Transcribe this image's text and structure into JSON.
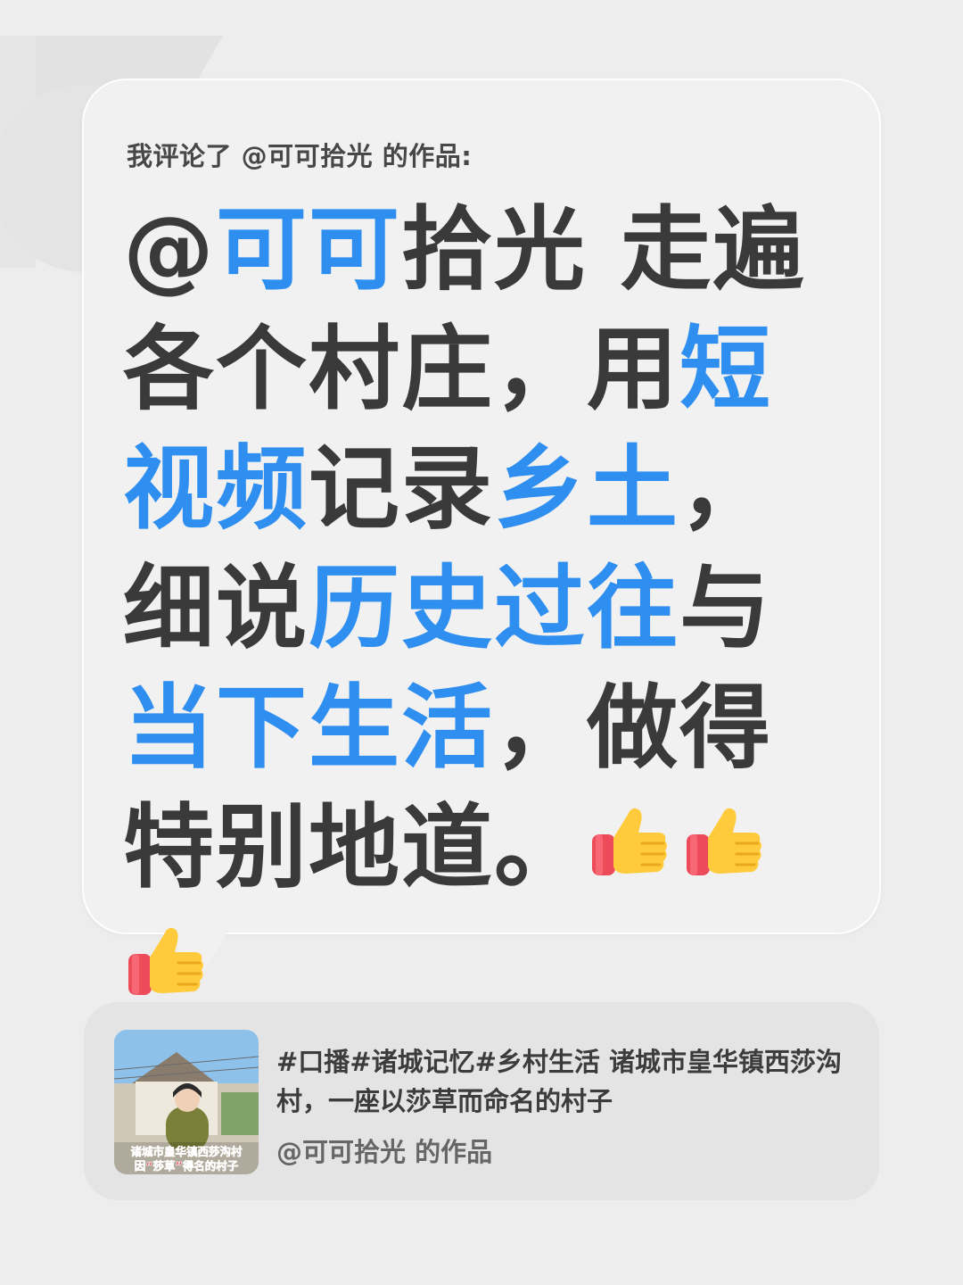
{
  "comment_header": "我评论了 @可可拾光 的作品:",
  "comment_segments": [
    {
      "text": "@",
      "highlight": false
    },
    {
      "text": "可可",
      "highlight": true
    },
    {
      "text": "拾光 走遍各个村庄，用",
      "highlight": false
    },
    {
      "text": "短视频",
      "highlight": true
    },
    {
      "text": "记录",
      "highlight": false
    },
    {
      "text": "乡土",
      "highlight": true
    },
    {
      "text": "，细说",
      "highlight": false
    },
    {
      "text": "历史过往",
      "highlight": true
    },
    {
      "text": "与",
      "highlight": false
    },
    {
      "text": "当下生活",
      "highlight": true
    },
    {
      "text": "，做得特别地道。",
      "highlight": false
    }
  ],
  "reactions": [
    "thumbs-up-icon",
    "thumbs-up-icon",
    "thumbs-up-icon"
  ],
  "video_card": {
    "title": "#口播#诸城记忆#乡村生活 诸城市皇华镇西莎沟村，一座以莎草而命名的村子",
    "author": "@可可拾光 的作品",
    "thumbnail_caption_line1": "诸城市皇华镇西莎沟村",
    "thumbnail_caption_line2": "因“莎草”得名的村子"
  },
  "colors": {
    "highlight": "#2f8ff0",
    "text": "#3a3a3a",
    "background": "#ededee",
    "bubble": "#f1f1f2",
    "card": "#e4e4e5"
  }
}
